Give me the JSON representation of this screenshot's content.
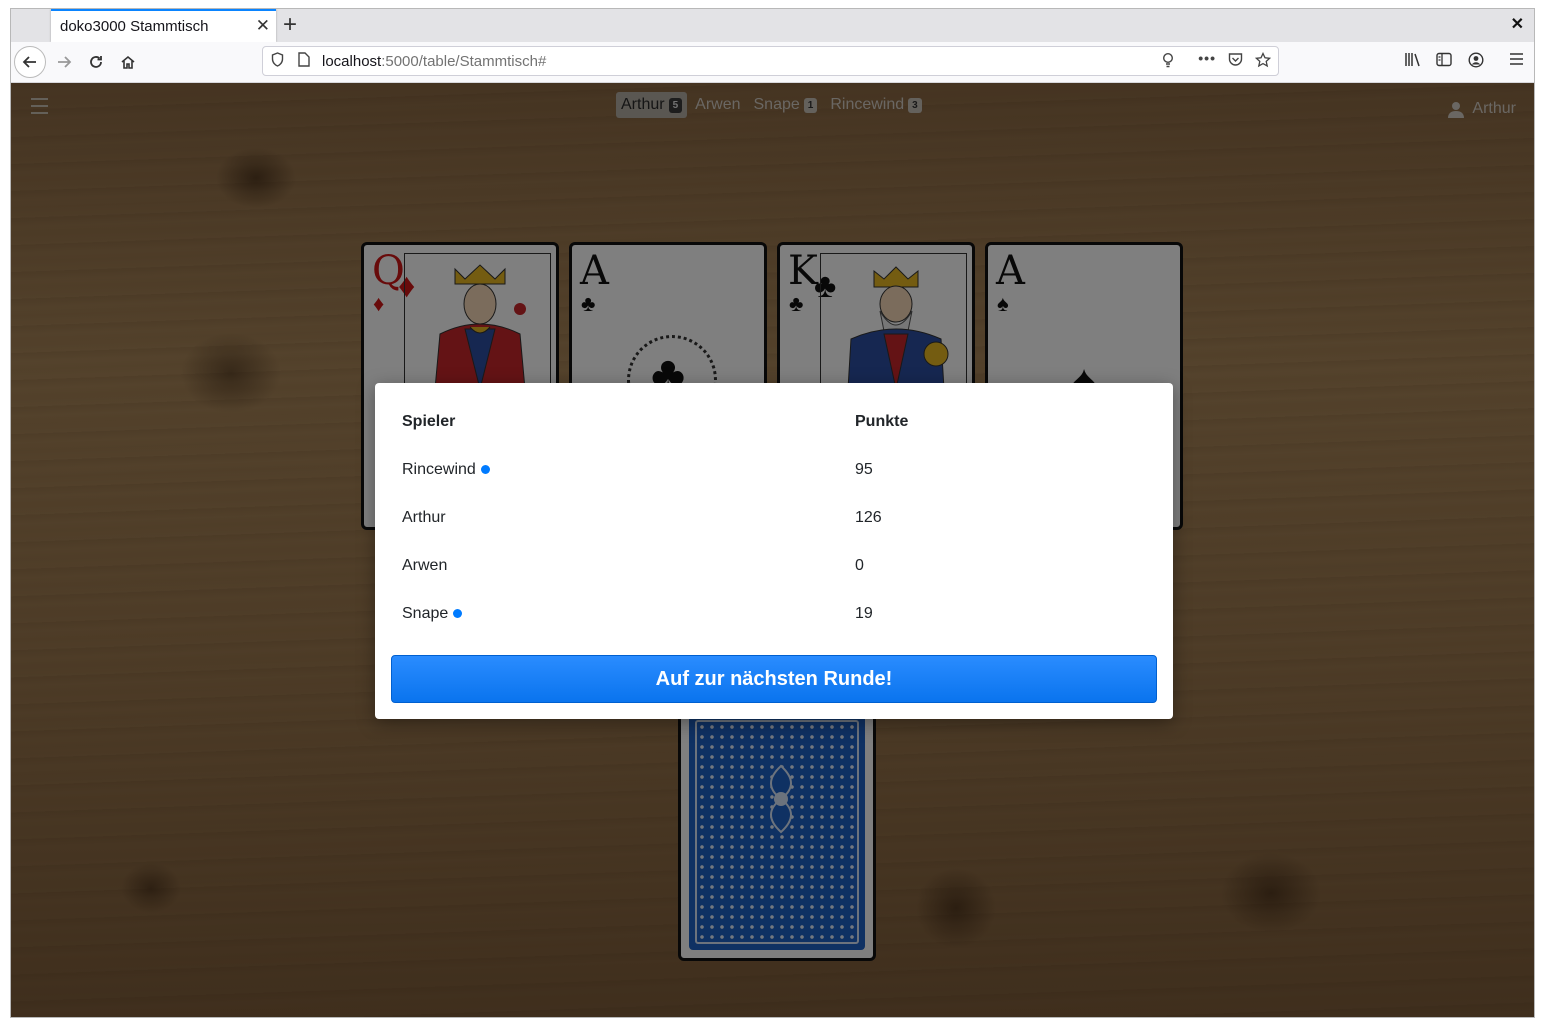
{
  "browser": {
    "tab_title": "doko3000 Stammtisch",
    "tab_close": "✕",
    "new_tab": "+",
    "window_close": "✕",
    "url_host": "localhost",
    "url_rest": ":5000/table/Stammtisch#"
  },
  "header": {
    "players": [
      {
        "name": "Arthur",
        "badge": "5",
        "active": true
      },
      {
        "name": "Arwen",
        "badge": null,
        "active": false
      },
      {
        "name": "Snape",
        "badge": "1",
        "active": false
      },
      {
        "name": "Rincewind",
        "badge": "3",
        "active": false
      }
    ],
    "current_user": "Arthur"
  },
  "cards": [
    {
      "rank": "Q",
      "suit": "♦",
      "color": "#d01616"
    },
    {
      "rank": "A",
      "suit": "♣",
      "color": "#111111"
    },
    {
      "rank": "K",
      "suit": "♣",
      "color": "#111111"
    },
    {
      "rank": "A",
      "suit": "♠",
      "color": "#111111"
    }
  ],
  "score_dialog": {
    "col_player": "Spieler",
    "col_points": "Punkte",
    "rows": [
      {
        "name": "Rincewind",
        "points": "95",
        "marked": true
      },
      {
        "name": "Arthur",
        "points": "126",
        "marked": false
      },
      {
        "name": "Arwen",
        "points": "0",
        "marked": false
      },
      {
        "name": "Snape",
        "points": "19",
        "marked": true
      }
    ],
    "button_label": "Auf zur nächsten Runde!"
  },
  "colors": {
    "accent": "#007bff",
    "tab_highlight": "#0a84ff"
  }
}
